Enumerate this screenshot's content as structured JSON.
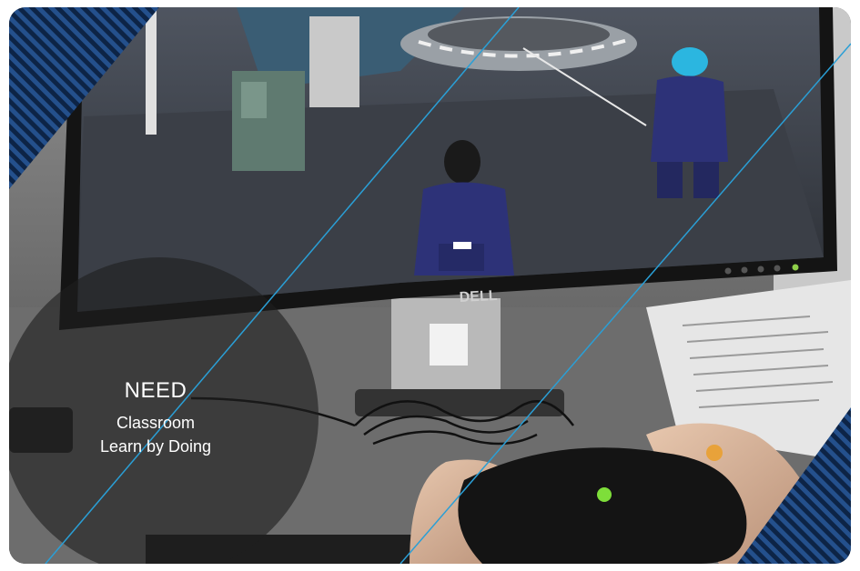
{
  "caption": {
    "title": "NEED",
    "lines": [
      "Classroom",
      "Learn by Doing"
    ]
  },
  "monitor": {
    "brand": "DELL"
  },
  "colors": {
    "accent_line": "#2a9fd6",
    "corner_stripes": "#1c3b6e",
    "overlay_circle": "#1e1e1e"
  }
}
